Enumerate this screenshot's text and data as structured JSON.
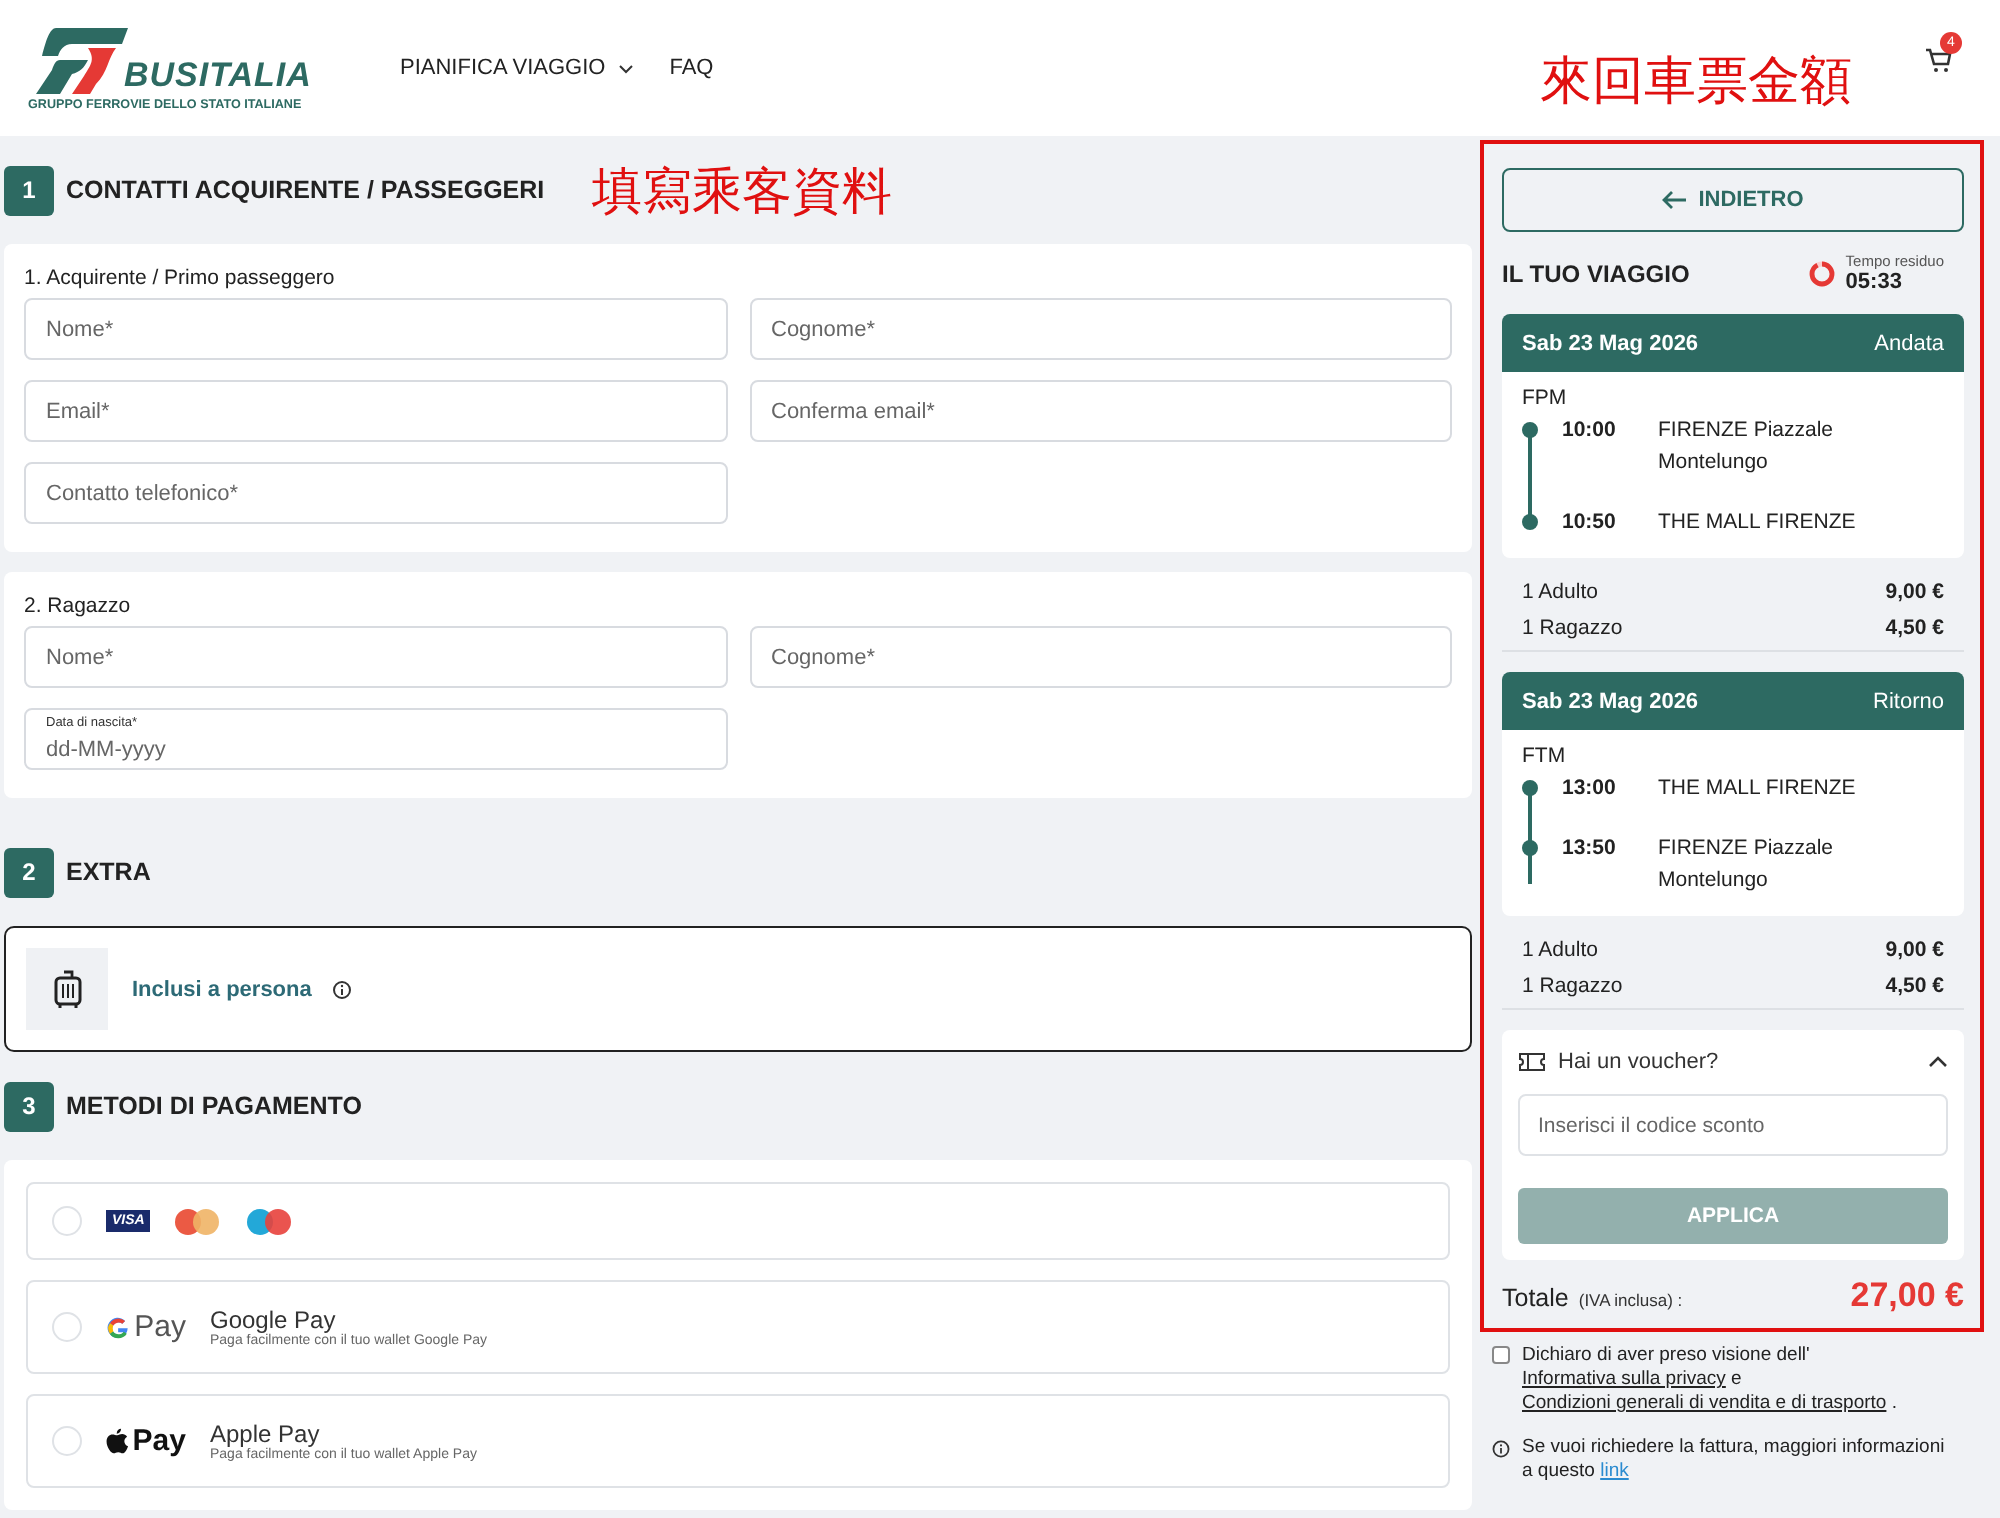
{
  "header": {
    "logo": {
      "name": "BUSITALIA",
      "tagline": "GRUPPO FERROVIE DELLO STATO ITALIANE"
    },
    "nav": [
      {
        "label": "PIANIFICA VIAGGIO",
        "dropdown": true
      },
      {
        "label": "FAQ",
        "dropdown": false
      }
    ],
    "annotation": "來回車票金額",
    "cart_count": "4"
  },
  "sections": [
    {
      "number": "1",
      "title": "CONTATTI ACQUIRENTE / PASSEGGERI",
      "annotation": "填寫乘客資料",
      "kind": "passengers",
      "passengers": [
        {
          "label": "1. Acquirente / Primo passeggero",
          "fields": [
            {
              "placeholder": "Nome*"
            },
            {
              "placeholder": "Cognome*"
            },
            {
              "placeholder": "Email*"
            },
            {
              "placeholder": "Conferma email*"
            },
            {
              "placeholder": "Contatto telefonico*"
            }
          ]
        },
        {
          "label": "2. Ragazzo",
          "fields": [
            {
              "placeholder": "Nome*"
            },
            {
              "placeholder": "Cognome*"
            },
            {
              "label": "Data di nascita*",
              "placeholder": "dd-MM-yyyy"
            }
          ]
        }
      ]
    },
    {
      "number": "2",
      "title": "EXTRA",
      "kind": "extras",
      "extras": [
        {
          "label": "Inclusi a persona"
        }
      ]
    },
    {
      "number": "3",
      "title": "METODI DI PAGAMENTO",
      "kind": "payment",
      "methods": [
        {
          "kind": "cards",
          "selected": false,
          "badge": "VISA"
        },
        {
          "kind": "gpay",
          "selected": false,
          "logo": "Pay",
          "name": "Google Pay",
          "description": "Paga facilmente con il tuo wallet Google Pay"
        },
        {
          "kind": "applepay",
          "selected": false,
          "logo": "Pay",
          "name": "Apple Pay",
          "description": "Paga facilmente con il tuo wallet Apple Pay"
        }
      ]
    }
  ],
  "summary": {
    "back_button": "INDIETRO",
    "title": "IL TUO VIAGGIO",
    "timer": {
      "label": "Tempo residuo",
      "value": "05:33",
      "level": 0.92
    },
    "trips": [
      {
        "date": "Sab 23 Mag 2026",
        "direction": "Andata",
        "code": "FPM",
        "stops": [
          {
            "time": "10:00",
            "place": "FIRENZE Piazzale Montelungo"
          },
          {
            "time": "10:50",
            "place": "THE MALL FIRENZE"
          }
        ],
        "fares": [
          {
            "label": "1 Adulto",
            "price": "9,00 €"
          },
          {
            "label": "1 Ragazzo",
            "price": "4,50 €"
          }
        ]
      },
      {
        "date": "Sab 23 Mag 2026",
        "direction": "Ritorno",
        "code": "FTM",
        "stops": [
          {
            "time": "13:00",
            "place": "THE MALL FIRENZE"
          },
          {
            "time": "13:50",
            "place": "FIRENZE Piazzale Montelungo"
          }
        ],
        "fares": [
          {
            "label": "1 Adulto",
            "price": "9,00 €"
          },
          {
            "label": "1 Ragazzo",
            "price": "4,50 €"
          }
        ]
      }
    ],
    "voucher": {
      "label": "Hai un voucher?",
      "expanded": true,
      "placeholder": "Inserisci il codice sconto",
      "button": "APPLICA"
    },
    "total": {
      "label": "Totale",
      "note": "(IVA inclusa) :",
      "amount": "27,00 €"
    },
    "consent": {
      "checked": false,
      "parts": [
        {
          "text": "Dichiaro di aver preso visione dell' ",
          "link": false
        },
        {
          "text": "Informativa sulla privacy",
          "link": true
        },
        {
          "text": " e ",
          "link": false
        },
        {
          "text": "Condizioni generali di vendita e di trasporto",
          "link": true
        },
        {
          "text": " .",
          "link": false
        }
      ]
    },
    "invoice_note": {
      "parts": [
        {
          "text": "Se vuoi richiedere la fattura, maggiori informazioni a questo ",
          "link": false
        },
        {
          "text": "link",
          "link": true
        }
      ]
    }
  }
}
